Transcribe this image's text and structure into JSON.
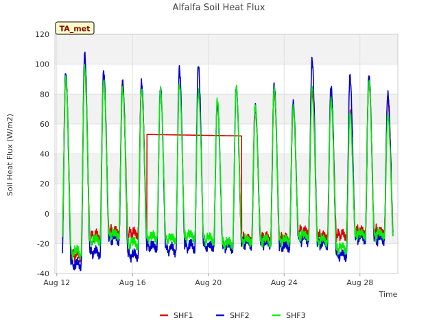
{
  "chart_data": {
    "type": "line",
    "title": "Alfalfa Soil Heat Flux",
    "xlabel": "Time",
    "ylabel": "Soil Heat Flux (W/m2)",
    "badge": "TA_met",
    "x_origin": "2023-08-12",
    "xlim": [
      -0.1,
      18.0
    ],
    "ylim": [
      -40,
      120
    ],
    "y_ticks": [
      -40,
      -20,
      0,
      20,
      40,
      60,
      80,
      100,
      120
    ],
    "x_ticks": [
      {
        "day": 0,
        "label": "Aug 12"
      },
      {
        "day": 4,
        "label": "Aug 16"
      },
      {
        "day": 8,
        "label": "Aug 20"
      },
      {
        "day": 12,
        "label": "Aug 24"
      },
      {
        "day": 16,
        "label": "Aug 28"
      }
    ],
    "grid": true,
    "legend_position": "bottom",
    "series": [
      {
        "name": "SHF1",
        "color": "#dd0000",
        "peaks": [
          92,
          97,
          93,
          88,
          86,
          72,
          93,
          93,
          72,
          78,
          70,
          83,
          70,
          82,
          81,
          68,
          90,
          78
        ],
        "troughs": [
          -18,
          -28,
          -15,
          -12,
          -13,
          -14,
          -16,
          -16,
          -14,
          -18,
          -17,
          -16,
          -17,
          -12,
          -15,
          -14,
          -12,
          -12
        ],
        "gap": {
          "start": 4.75,
          "end": 9.75,
          "from": 53,
          "to": 52
        }
      },
      {
        "name": "SHF2",
        "color": "#0000cc",
        "peaks": [
          94,
          107,
          95,
          88,
          88,
          84,
          97,
          99,
          74,
          84,
          72,
          86,
          75,
          103,
          85,
          92,
          92,
          80
        ],
        "troughs": [
          -30,
          -34,
          -26,
          -17,
          -28,
          -22,
          -24,
          -22,
          -22,
          -22,
          -20,
          -20,
          -22,
          -17,
          -20,
          -28,
          -16,
          -17
        ],
        "gap": null
      },
      {
        "name": "SHF3",
        "color": "#00ee00",
        "peaks": [
          91,
          98,
          89,
          84,
          83,
          83,
          86,
          82,
          76,
          85,
          72,
          84,
          71,
          85,
          76,
          67,
          88,
          66
        ],
        "troughs": [
          -20,
          -26,
          -18,
          -14,
          -20,
          -16,
          -17,
          -15,
          -17,
          -20,
          -18,
          -18,
          -18,
          -15,
          -18,
          -23,
          -14,
          -14
        ],
        "gap": null
      }
    ]
  }
}
